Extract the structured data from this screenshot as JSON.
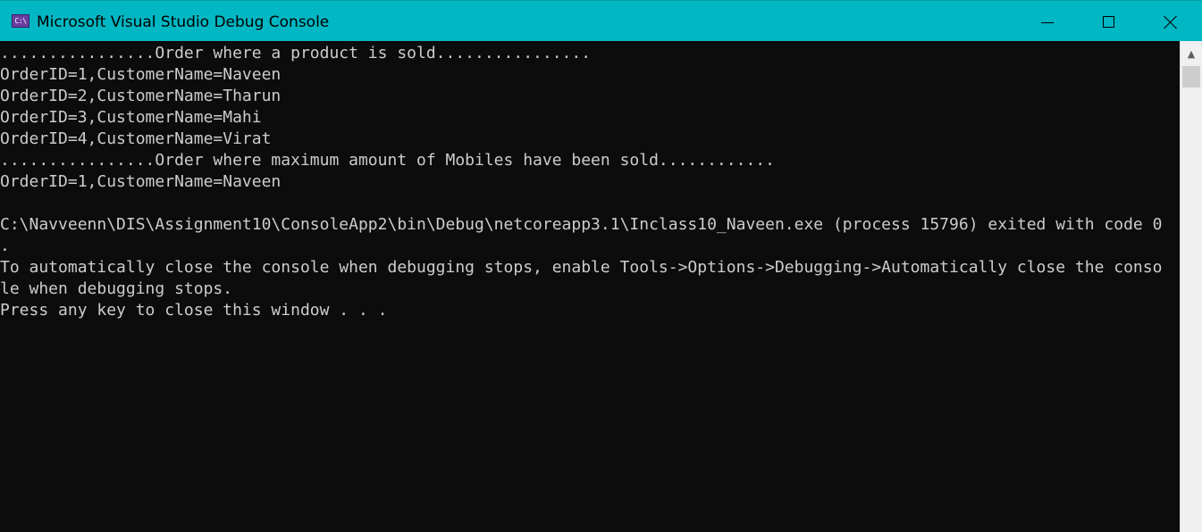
{
  "window": {
    "title": "Microsoft Visual Studio Debug Console",
    "icon_text": "C:\\",
    "icon_name": "console-app-icon",
    "colors": {
      "titlebar": "#00b7c3",
      "console_background": "#0c0c0c",
      "console_text": "#cccccc"
    }
  },
  "controls": {
    "minimize_icon": "minimize-icon",
    "maximize_icon": "maximize-icon",
    "close_icon": "close-icon"
  },
  "console": {
    "lines": [
      "................Order where a product is sold................",
      "OrderID=1,CustomerName=Naveen",
      "OrderID=2,CustomerName=Tharun",
      "OrderID=3,CustomerName=Mahi",
      "OrderID=4,CustomerName=Virat",
      "................Order where maximum amount of Mobiles have been sold............",
      "OrderID=1,CustomerName=Naveen",
      "",
      "C:\\Navveenn\\DIS\\Assignment10\\ConsoleApp2\\bin\\Debug\\netcoreapp3.1\\Inclass10_Naveen.exe (process 15796) exited with code 0",
      ".",
      "To automatically close the console when debugging stops, enable Tools->Options->Debugging->Automatically close the conso",
      "le when debugging stops.",
      "Press any key to close this window . . ."
    ]
  },
  "scrollbar": {
    "up_arrow": "▲",
    "up_icon": "scroll-up-arrow-icon"
  }
}
